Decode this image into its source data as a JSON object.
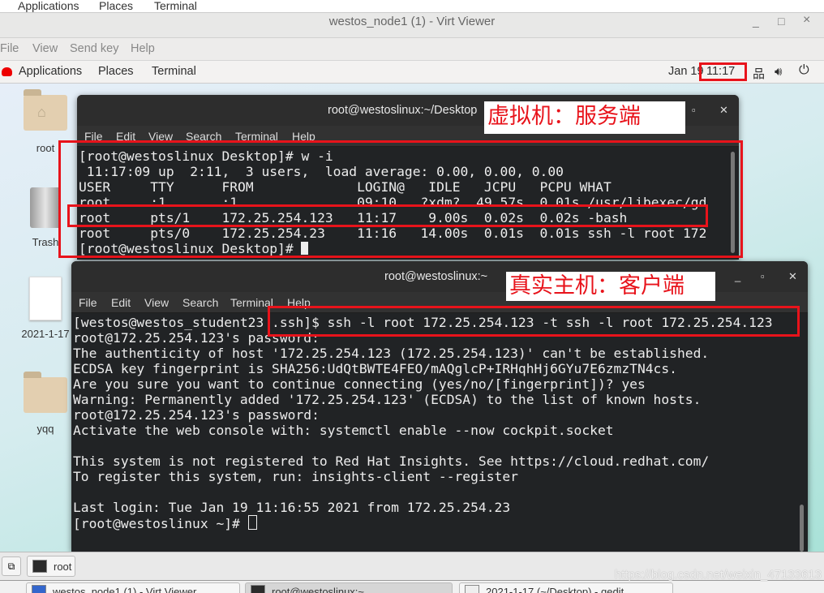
{
  "host_panel": {
    "items": [
      "Applications",
      "Places",
      "Terminal"
    ]
  },
  "viewer": {
    "title": "westos_node1 (1) - Virt Viewer",
    "controls": [
      "_",
      "□",
      "×"
    ],
    "menu": [
      "File",
      "View",
      "Send key",
      "Help"
    ]
  },
  "guest_panel": {
    "items": [
      "Applications",
      "Places",
      "Terminal"
    ],
    "date": "Jan 19",
    "time": "11:17",
    "icons": [
      "network-icon",
      "volume-icon",
      "power-icon"
    ]
  },
  "desktop_icons": [
    {
      "label": "root",
      "icon": "home-folder-icon"
    },
    {
      "label": "Trash",
      "icon": "trash-icon"
    },
    {
      "label": "2021-1-17",
      "icon": "text-file-icon"
    },
    {
      "label": "yqq",
      "icon": "folder-icon"
    }
  ],
  "term1": {
    "title": "root@westoslinux:~/Desktop",
    "menu": [
      "File",
      "Edit",
      "View",
      "Search",
      "Terminal",
      "Help"
    ],
    "annotation": "虚拟机：服务端",
    "lines": [
      "[root@westoslinux Desktop]# w -i",
      " 11:17:09 up  2:11,  3 users,  load average: 0.00, 0.00, 0.00",
      "USER     TTY      FROM             LOGIN@   IDLE   JCPU   PCPU WHAT",
      "root     :1       :1               09:10   ?xdm?  49.57s  0.01s /usr/libexec/gd",
      "root     pts/1    172.25.254.123   11:17    9.00s  0.02s  0.02s -bash",
      "root     pts/0    172.25.254.23    11:16   14.00s  0.01s  0.01s ssh -l root 172"
    ],
    "prompt": "[root@westoslinux Desktop]# "
  },
  "term2": {
    "title": "root@westoslinux:~",
    "menu": [
      "File",
      "Edit",
      "View",
      "Search",
      "Terminal",
      "Help"
    ],
    "annotation": "真实主机：客户端",
    "lines": [
      "[westos@westos_student23 .ssh]$ ssh -l root 172.25.254.123 -t ssh -l root 172.25.254.123",
      "root@172.25.254.123's password:",
      "The authenticity of host '172.25.254.123 (172.25.254.123)' can't be established.",
      "ECDSA key fingerprint is SHA256:UdQtBWTE4FEO/mAQglcP+IRHqhHj6GYu7E6zmzTN4cs.",
      "Are you sure you want to continue connecting (yes/no/[fingerprint])? yes",
      "Warning: Permanently added '172.25.254.123' (ECDSA) to the list of known hosts.",
      "root@172.25.254.123's password:",
      "Activate the web console with: systemctl enable --now cockpit.socket",
      "",
      "This system is not registered to Red Hat Insights. See https://cloud.redhat.com/",
      "To register this system, run: insights-client --register",
      "",
      "Last login: Tue Jan 19 11:16:55 2021 from 172.25.254.23"
    ],
    "prompt": "[root@westoslinux ~]# "
  },
  "guest_taskbar": {
    "tasks": [
      "root"
    ]
  },
  "host_taskbar": {
    "tasks": [
      "westos_node1 (1) - Virt Viewer",
      "root@westoslinux:~",
      "2021-1-17 (~/Desktop) - gedit"
    ]
  },
  "watermark": "https://blog.csdn.net/weixin_47133613",
  "colors": {
    "annotation_red": "#e8131b",
    "terminal_bg": "#212325"
  }
}
